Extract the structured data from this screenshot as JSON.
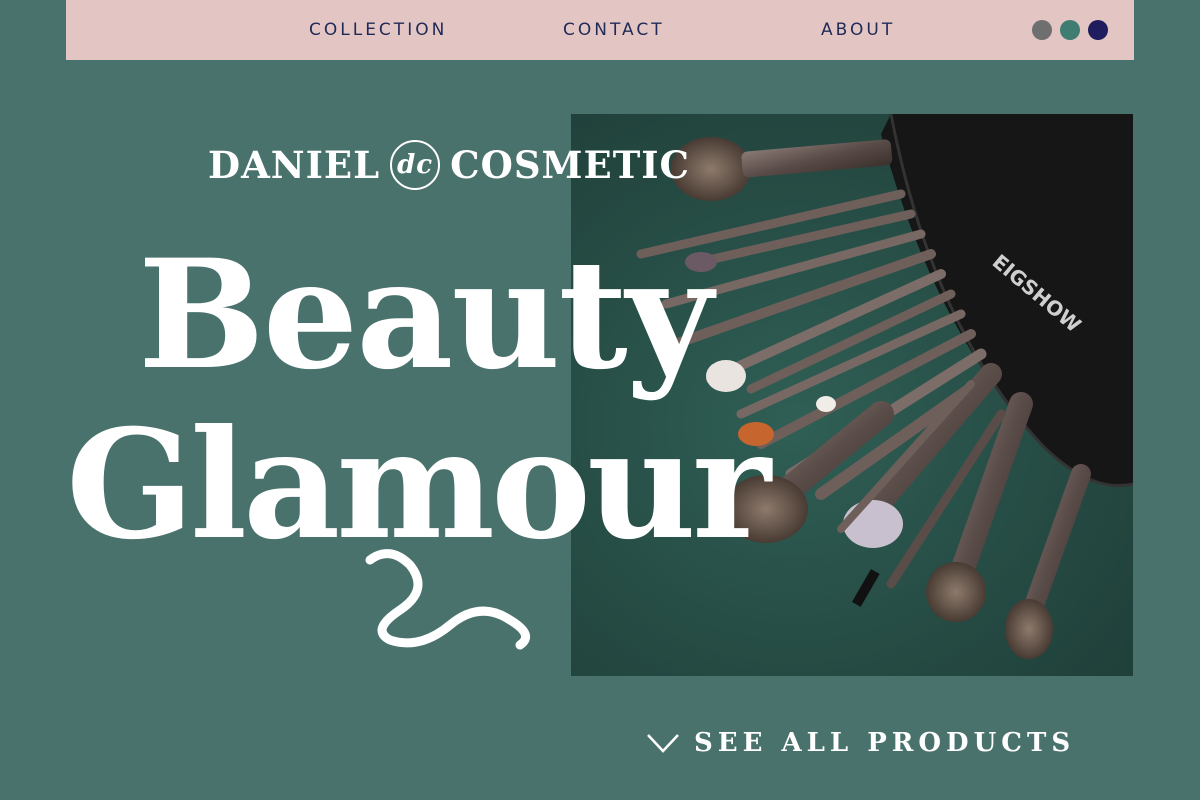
{
  "nav": {
    "links": [
      "COLLECTION",
      "CONTACT",
      "ABOUT"
    ],
    "color_dots": [
      "#6f6f6f",
      "#3f7c72",
      "#1f1d5e"
    ]
  },
  "brand": {
    "name_left": "DANIEL",
    "monogram": "dc",
    "name_right": "COSMETIC"
  },
  "hero": {
    "line1": "Beauty",
    "line2": "Glamour",
    "pouch_brand": "EIGSHOW"
  },
  "cta": {
    "label": "SEE ALL PRODUCTS"
  },
  "colors": {
    "background": "#4a726c",
    "topbar": "#e3c6c4",
    "nav_text": "#1f2a57",
    "headline": "#ffffff"
  }
}
